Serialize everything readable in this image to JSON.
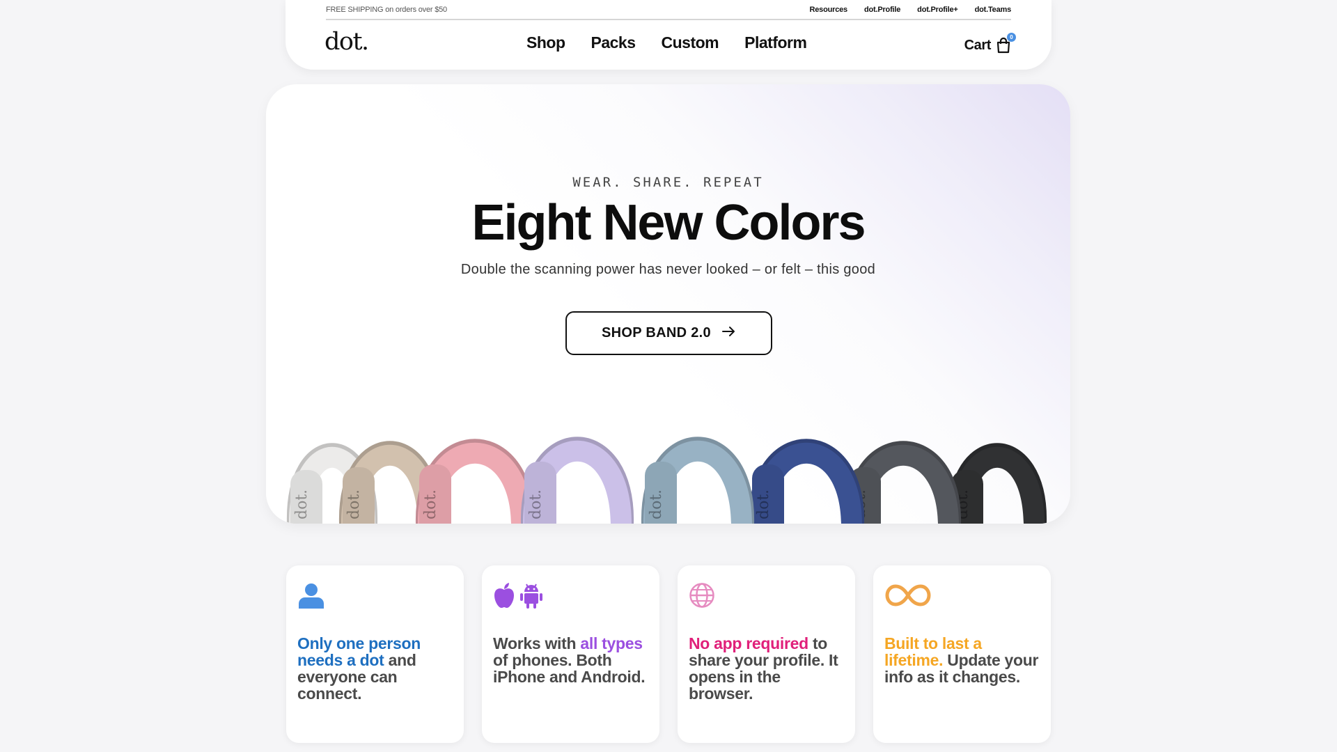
{
  "header": {
    "shipping": "FREE SHIPPING on orders over $50",
    "top_links": [
      "Resources",
      "dot.Profile",
      "dot.Profile+",
      "dot.Teams"
    ],
    "logo": "dot.",
    "nav": [
      "Shop",
      "Packs",
      "Custom",
      "Platform"
    ],
    "cart_label": "Cart",
    "cart_count": "0"
  },
  "hero": {
    "eyebrow": "WEAR. SHARE. REPEAT",
    "title": "Eight New Colors",
    "subtitle": "Double the scanning power has never looked – or felt – this good",
    "cta": "SHOP BAND 2.0",
    "band_label": "dot.",
    "band_colors": [
      "#ecebea",
      "#d2c1ae",
      "#eeaab3",
      "#cbc0e8",
      "#98b2c4",
      "#3a5192",
      "#54575d",
      "#303133"
    ]
  },
  "features": [
    {
      "icon": "person-icon",
      "parts": [
        {
          "t": "Only one person needs a dot",
          "c": "hl-blue"
        },
        {
          "t": " and everyone can connect.",
          "c": ""
        }
      ]
    },
    {
      "icon": "apple-android-icon",
      "parts": [
        {
          "t": "Works with ",
          "c": ""
        },
        {
          "t": "all types",
          "c": "hl-purple"
        },
        {
          "t": " of phones. Both iPhone and Android.",
          "c": ""
        }
      ]
    },
    {
      "icon": "globe-icon",
      "parts": [
        {
          "t": "No app required",
          "c": "hl-pink"
        },
        {
          "t": " to share your profile. It opens in the browser.",
          "c": ""
        }
      ]
    },
    {
      "icon": "infinity-icon",
      "parts": [
        {
          "t": "Built to last a lifetime.",
          "c": "hl-orange"
        },
        {
          "t": " Update your info as it changes.",
          "c": ""
        }
      ]
    }
  ],
  "colors": {
    "accent_blue": "#1e6fc0",
    "accent_purple": "#9b4fe0",
    "accent_pink": "#e0207a",
    "accent_orange": "#f5a623",
    "badge": "#4a90e2"
  }
}
